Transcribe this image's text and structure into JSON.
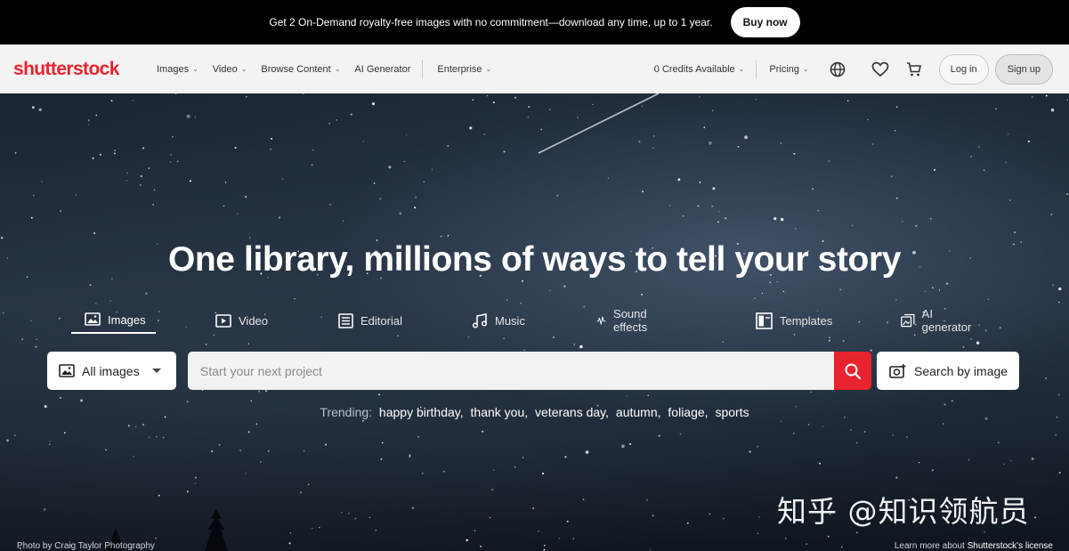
{
  "promo": {
    "text": "Get 2 On-Demand royalty-free images with no commitment—download any time, up to 1 year.",
    "button": "Buy now"
  },
  "nav": {
    "logo": "shutterstock",
    "items": [
      {
        "label": "Images",
        "has_dropdown": true
      },
      {
        "label": "Video",
        "has_dropdown": true
      },
      {
        "label": "Browse Content",
        "has_dropdown": true
      },
      {
        "label": "AI Generator",
        "has_dropdown": false
      },
      {
        "label": "Enterprise",
        "has_dropdown": true
      }
    ],
    "credits": "0 Credits Available",
    "pricing": "Pricing",
    "icons": [
      "globe-icon",
      "heart-icon",
      "cart-icon"
    ],
    "login": "Log in",
    "signup": "Sign up"
  },
  "hero": {
    "headline": "One library, millions of ways to tell your story",
    "tabs": [
      {
        "label": "Images",
        "icon": "image-icon",
        "active": true
      },
      {
        "label": "Video",
        "icon": "video-icon",
        "active": false
      },
      {
        "label": "Editorial",
        "icon": "editorial-icon",
        "active": false
      },
      {
        "label": "Music",
        "icon": "music-icon",
        "active": false
      },
      {
        "label": "Sound effects",
        "icon": "waveform-icon",
        "active": false
      },
      {
        "label": "Templates",
        "icon": "templates-icon",
        "active": false
      },
      {
        "label": "AI generator",
        "icon": "ai-generator-icon",
        "active": false
      }
    ],
    "search": {
      "type_select": "All images",
      "placeholder": "Start your next project",
      "value": "",
      "image_search": "Search by image"
    },
    "trending": {
      "label": "Trending:",
      "terms": [
        "happy birthday,",
        "thank you,",
        "veterans day,",
        "autumn,",
        "foliage,",
        "sports"
      ]
    },
    "photo_credit_prefix": "Photo by",
    "photo_credit": "Craig Taylor Photography",
    "license_prefix": "Learn more about",
    "license_link": "Shutterstock's license"
  },
  "watermark": "知乎 @知识领航员",
  "colors": {
    "brand": "#e8242f",
    "promo_bg": "#000000",
    "nav_bg": "#f3f3f3"
  }
}
